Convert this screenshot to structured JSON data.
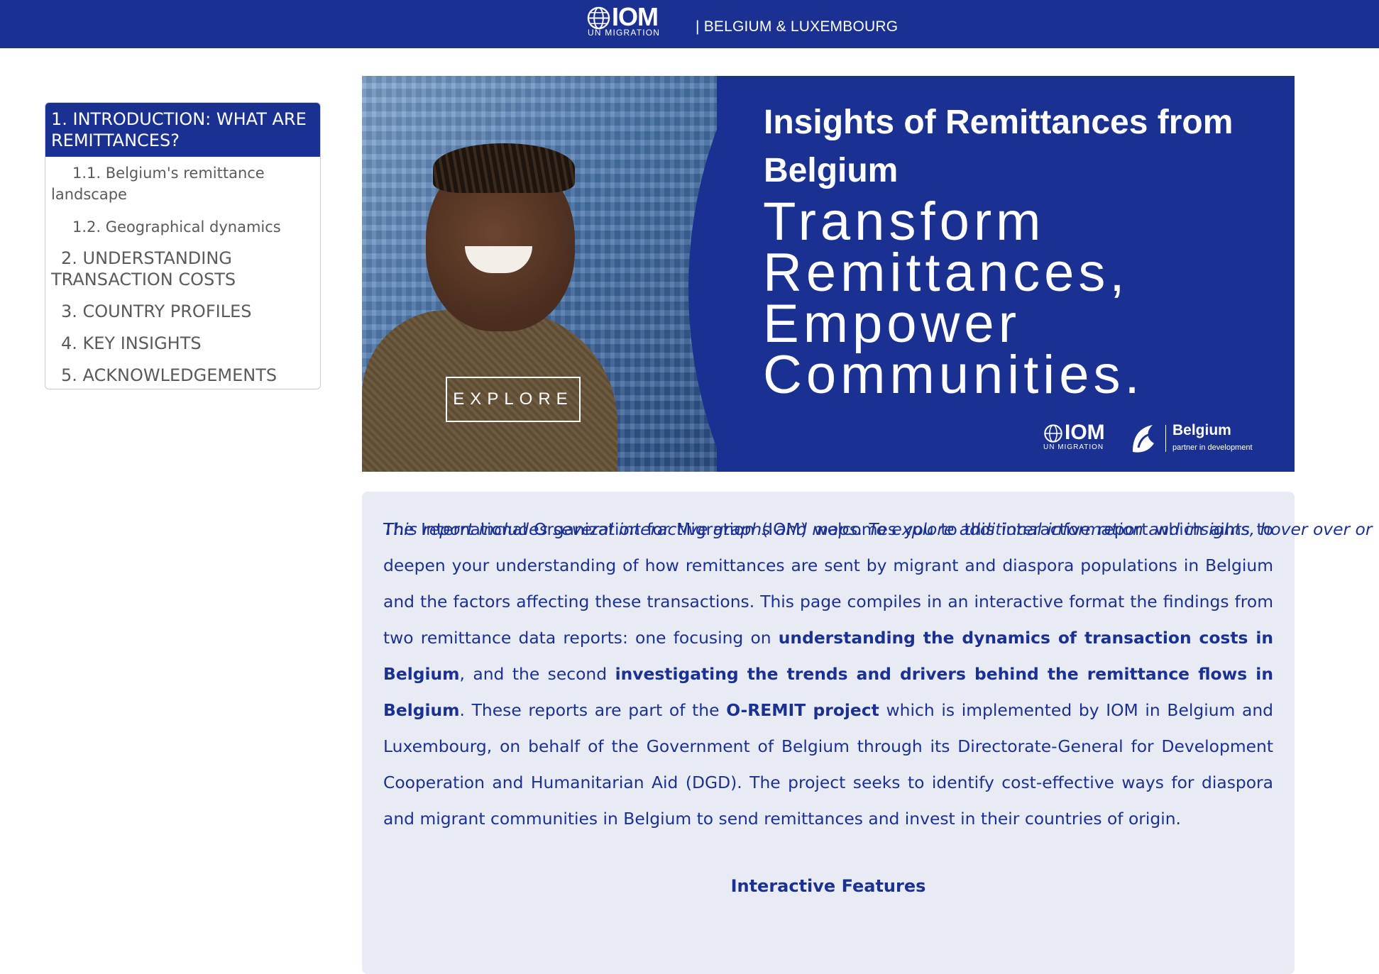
{
  "header": {
    "brand_name": "IOM",
    "brand_sub": "UN MIGRATION",
    "country": "| BELGIUM & LUXEMBOURG"
  },
  "toc": {
    "items": [
      {
        "label": "1. INTRODUCTION: WHAT ARE REMITTANCES?",
        "level": "top",
        "active": true
      },
      {
        "label": "1.1. Belgium's remittance landscape",
        "level": "sub"
      },
      {
        "label": "1.2. Geographical dynamics",
        "level": "sub"
      },
      {
        "label": "2. UNDERSTANDING TRANSACTION COSTS",
        "level": "top"
      },
      {
        "label": "3. COUNTRY PROFILES",
        "level": "top"
      },
      {
        "label": "4. KEY INSIGHTS",
        "level": "top"
      },
      {
        "label": "5. ACKNOWLEDGEMENTS",
        "level": "top"
      }
    ]
  },
  "banner": {
    "title": "Insights of Remittances from Belgium",
    "tagline": "Transform Remittances, Empower Communities.",
    "explore_label": "EXPLORE",
    "logo_iom": "IOM",
    "logo_iom_sub": "UN MIGRATION",
    "logo_belgium": "Belgium",
    "logo_belgium_sub": "partner in development"
  },
  "intro": {
    "p1_a": "The International Organization for Migration (IOM) welcomes you to this interactive report which aims to deepen your understanding of how remittances are sent by migrant and diaspora populations in Belgium and the factors affecting these transactions. This page compiles in an interactive format the findings from two remittance data reports: one focusing on ",
    "p1_b": "understanding the dynamics of transaction costs in Belgium",
    "p1_c": ", and the second ",
    "p1_d": "investigating the trends and drivers behind the remittance flows in Belgium",
    "p1_e": ". These reports are part of the ",
    "p1_f": "O-REMIT project",
    "p1_g": " which is implemented by IOM in Belgium and Luxembourg, on behalf of the Government of Belgium through its Directorate-General for Development Cooperation and Humanitarian Aid (DGD). The project seeks to identify cost-effective ways for diaspora and migrant communities in Belgium to send remittances and invest in their countries of origin.",
    "features_title": "Interactive Features",
    "features_text": "This report includes several interactive graphs and maps. To explore additional information and insights, hover over or"
  },
  "colors": {
    "brand_blue": "#1b3192",
    "card_bg": "#e8ebf4",
    "toc_text": "#5a5a5a"
  }
}
